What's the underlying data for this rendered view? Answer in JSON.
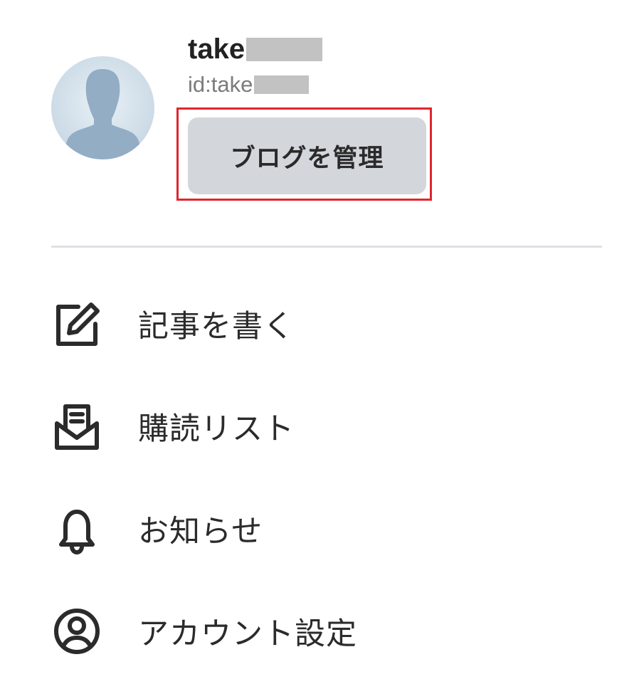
{
  "profile": {
    "username": "take",
    "user_id": "id:take",
    "manage_button_label": "ブログを管理"
  },
  "menu": {
    "items": [
      {
        "label": "記事を書く",
        "icon": "edit-icon"
      },
      {
        "label": "購読リスト",
        "icon": "mail-open-icon"
      },
      {
        "label": "お知らせ",
        "icon": "bell-icon"
      },
      {
        "label": "アカウント設定",
        "icon": "user-circle-icon"
      }
    ]
  },
  "colors": {
    "highlight": "#e0262d",
    "button_bg": "#d3d7dc",
    "avatar_bg": "#cfdde8",
    "avatar_silhouette": "#92adc4",
    "redaction": "#c2c2c2",
    "divider": "#dde1e4"
  }
}
